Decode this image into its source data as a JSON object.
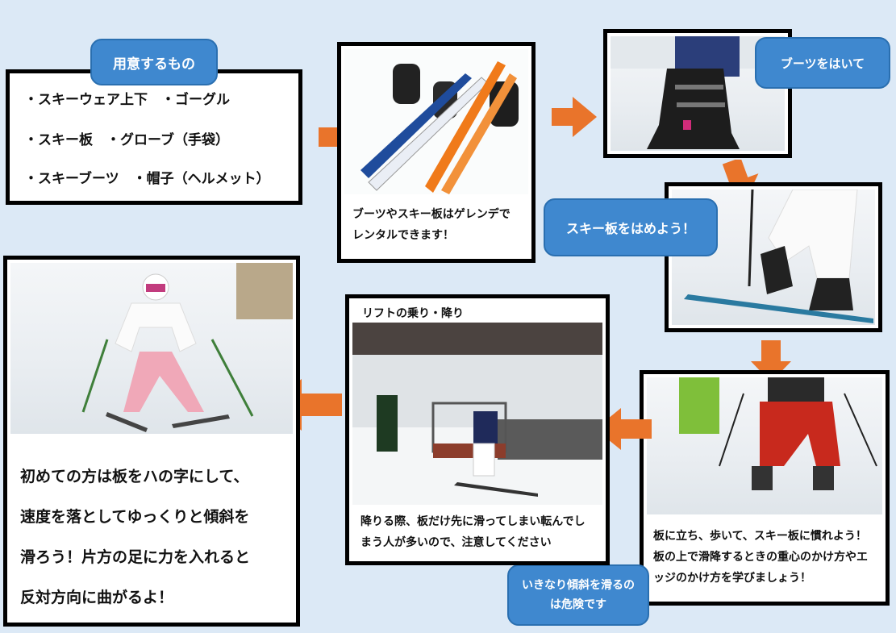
{
  "prepare": {
    "title": "用意するもの",
    "items": [
      "・スキーウェア上下　・ゴーグル",
      "・スキー板　・グローブ（手袋）",
      "・スキーブーツ　・帽子（ヘルメット）"
    ]
  },
  "rental": {
    "text_lines": [
      "ブーツやスキー板はゲレンデで",
      "レンタルできます！"
    ]
  },
  "boots": {
    "bubble": "ブーツをはいて"
  },
  "skis": {
    "bubble": "スキー板をはめよう！"
  },
  "walk": {
    "text_lines": [
      "板に立ち、歩いて、スキー板に慣れよう！",
      "板の上で滑降するときの重心のかけ方やエ",
      "ッジのかけ方を学びましょう！"
    ],
    "warning": "いきなり傾斜を滑るのは危険です"
  },
  "lift": {
    "title": "リフトの乗り・降り",
    "text_lines": [
      "降りる際、板だけ先に滑ってしまい転んでし",
      "まう人が多いので、注意してください"
    ]
  },
  "beginner": {
    "text_lines": [
      "初めての方は板をハの字にして、",
      "速度を落としてゆっくりと傾斜を",
      "滑ろう！片方の足に力を入れると",
      "反対方向に曲がるよ！"
    ]
  },
  "colors": {
    "bubble": "#3f88cf",
    "arrow": "#e9742b"
  }
}
